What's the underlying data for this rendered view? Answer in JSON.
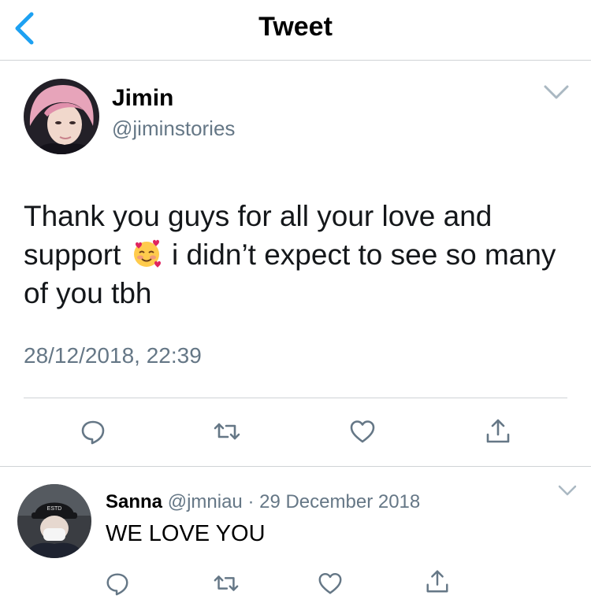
{
  "header": {
    "title": "Tweet"
  },
  "tweet": {
    "author_name": "Jimin",
    "author_handle": "@jiminstories",
    "text_part1": "Thank you guys for all your love and support",
    "emoji": "smiling-face-with-hearts-icon",
    "text_part2": "i didn’t expect to see so many of you tbh",
    "timestamp": "28/12/2018, 22:39"
  },
  "reply": {
    "author_name": "Sanna",
    "author_handle": "@jmniau",
    "separator": "·",
    "date": "29 December 2018",
    "text": "WE LOVE YOU"
  },
  "icons": {
    "back": "chevron-left-icon",
    "more": "chevron-down-icon",
    "reply": "comment-icon",
    "retweet": "retweet-icon",
    "like": "heart-icon",
    "share": "share-icon"
  },
  "colors": {
    "accent": "#1da1f2",
    "secondary_text": "#657786",
    "divider": "#cfd3d6"
  }
}
